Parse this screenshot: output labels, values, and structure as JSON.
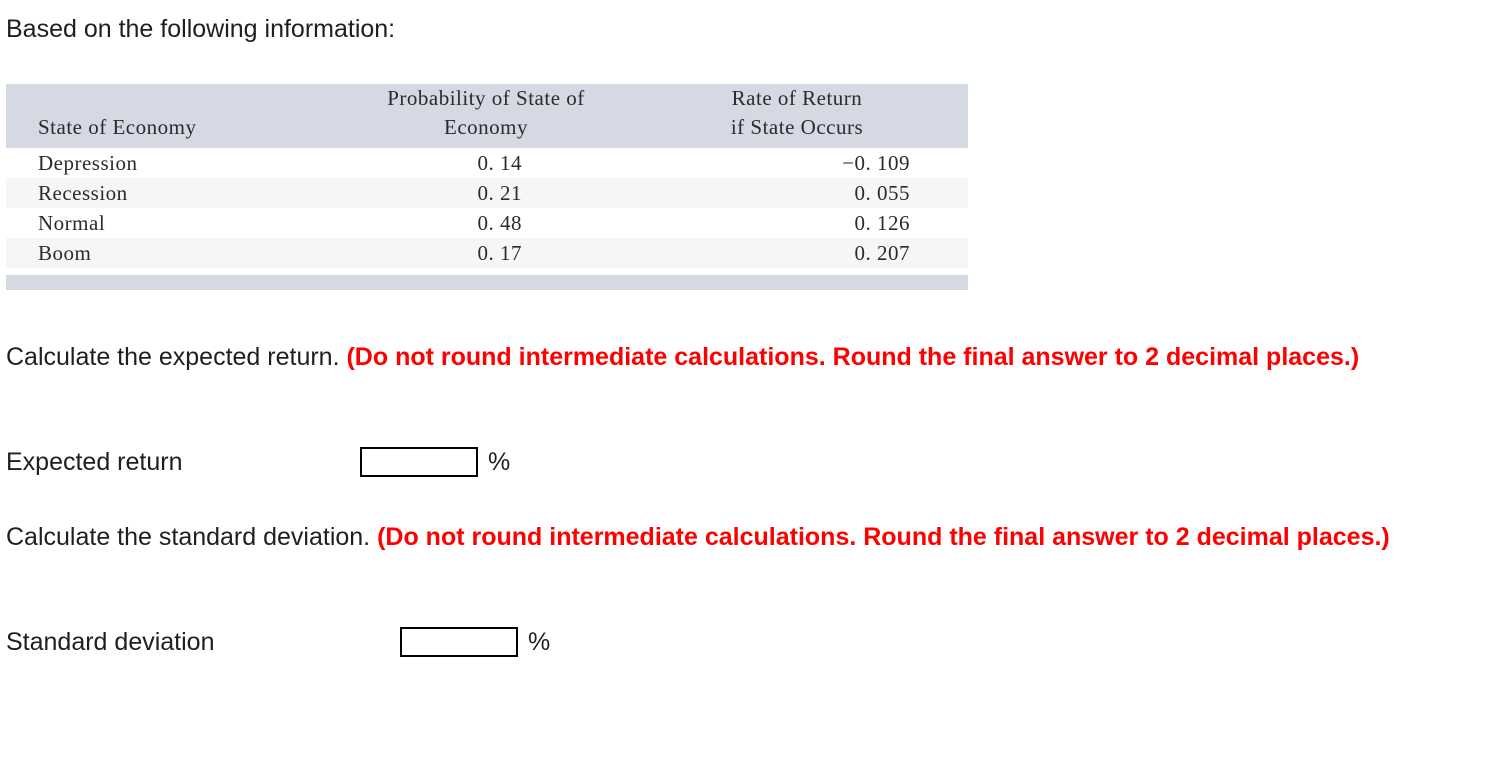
{
  "intro": "Based on the following information:",
  "table": {
    "headers": {
      "col1": [
        "State of Economy"
      ],
      "col2": [
        "Probability of State of",
        "Economy"
      ],
      "col3": [
        "Rate of Return",
        "if State Occurs"
      ]
    },
    "rows": [
      {
        "state": "Depression",
        "probability": "0. 14",
        "rate": "−0. 109"
      },
      {
        "state": "Recession",
        "probability": "0. 21",
        "rate": "0. 055"
      },
      {
        "state": "Normal",
        "probability": "0. 48",
        "rate": "0. 126"
      },
      {
        "state": "Boom",
        "probability": "0. 17",
        "rate": "0. 207"
      }
    ],
    "header_bg": "#d4d9e3",
    "stripe_bg": "#f6f6f6"
  },
  "questions": {
    "expected": {
      "plain": "Calculate the expected return. ",
      "emphasis": "(Do not round intermediate calculations. Round the final answer to 2 decimal places.)"
    },
    "stddev": {
      "plain": "Calculate the standard deviation. ",
      "emphasis": "(Do not round intermediate calculations. Round the final answer to 2 decimal places.)"
    },
    "emphasis_color": "#fe0000"
  },
  "answers": {
    "expected": {
      "label": "Expected return",
      "value": "",
      "placeholder": "",
      "unit": "%"
    },
    "stddev": {
      "label": "Standard deviation",
      "value": "",
      "placeholder": "",
      "unit": "%"
    }
  }
}
